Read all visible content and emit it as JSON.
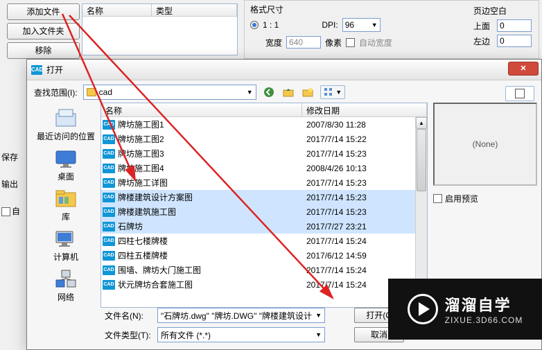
{
  "toolbar": {
    "add_file": "添加文件",
    "add_folder": "加入文件夹",
    "remove": "移除"
  },
  "filelist": {
    "col_name": "名称",
    "col_type": "类型"
  },
  "settings": {
    "format_label": "格式尺寸",
    "ratio_label": "1 : 1",
    "dpi_label": "DPI:",
    "dpi_value": "96",
    "width_label": "宽度",
    "width_value": "640",
    "px_label": "像素",
    "auto_width": "自动宽度",
    "margin_label": "页边空白",
    "top_label": "上面",
    "top_value": "0",
    "left_label": "左边",
    "left_value": "0"
  },
  "left_panel": {
    "save": "保存",
    "output": "输出",
    "auto": "自"
  },
  "dialog": {
    "title": "打开",
    "look_in_label": "查找范围(I):",
    "look_in_value": "cad",
    "hdr_name": "名称",
    "hdr_date": "修改日期",
    "places": {
      "recent": "最近访问的位置",
      "desktop": "桌面",
      "libraries": "库",
      "computer": "计算机",
      "network": "网络"
    },
    "files": [
      {
        "name": "牌坊施工图1",
        "date": "2007/8/30 11:28",
        "sel": false
      },
      {
        "name": "牌坊施工图2",
        "date": "2017/7/14 15:22",
        "sel": false
      },
      {
        "name": "牌坊施工图3",
        "date": "2017/7/14 15:23",
        "sel": false
      },
      {
        "name": "牌坊施工图4",
        "date": "2008/4/26 10:13",
        "sel": false
      },
      {
        "name": "牌坊施工详图",
        "date": "2017/7/14 15:23",
        "sel": false
      },
      {
        "name": "牌楼建筑设计方案图",
        "date": "2017/7/14 15:23",
        "sel": true
      },
      {
        "name": "牌楼建筑施工图",
        "date": "2017/7/14 15:23",
        "sel": true
      },
      {
        "name": "石牌坊",
        "date": "2017/7/27 23:21",
        "sel": true
      },
      {
        "name": "四柱七楼牌楼",
        "date": "2017/7/14 15:24",
        "sel": false
      },
      {
        "name": "四柱五楼牌楼",
        "date": "2017/6/12 14:59",
        "sel": false
      },
      {
        "name": "围墙、牌坊大门施工图",
        "date": "2017/7/14 15:24",
        "sel": false
      },
      {
        "name": "状元牌坊合套施工图",
        "date": "2017/7/14 15:24",
        "sel": false
      }
    ],
    "preview_none": "(None)",
    "preview_enable": "启用预览",
    "filename_label": "文件名(N):",
    "filename_value": "\"石牌坊.dwg\" \"牌坊.DWG\" \"牌楼建筑设计",
    "filetype_label": "文件类型(T):",
    "filetype_value": "所有文件 (*.*)",
    "open_btn": "打开(O",
    "cancel_btn": "取消"
  },
  "watermark": {
    "cn": "溜溜自学",
    "en": "ZIXUE.3D66.COM"
  }
}
